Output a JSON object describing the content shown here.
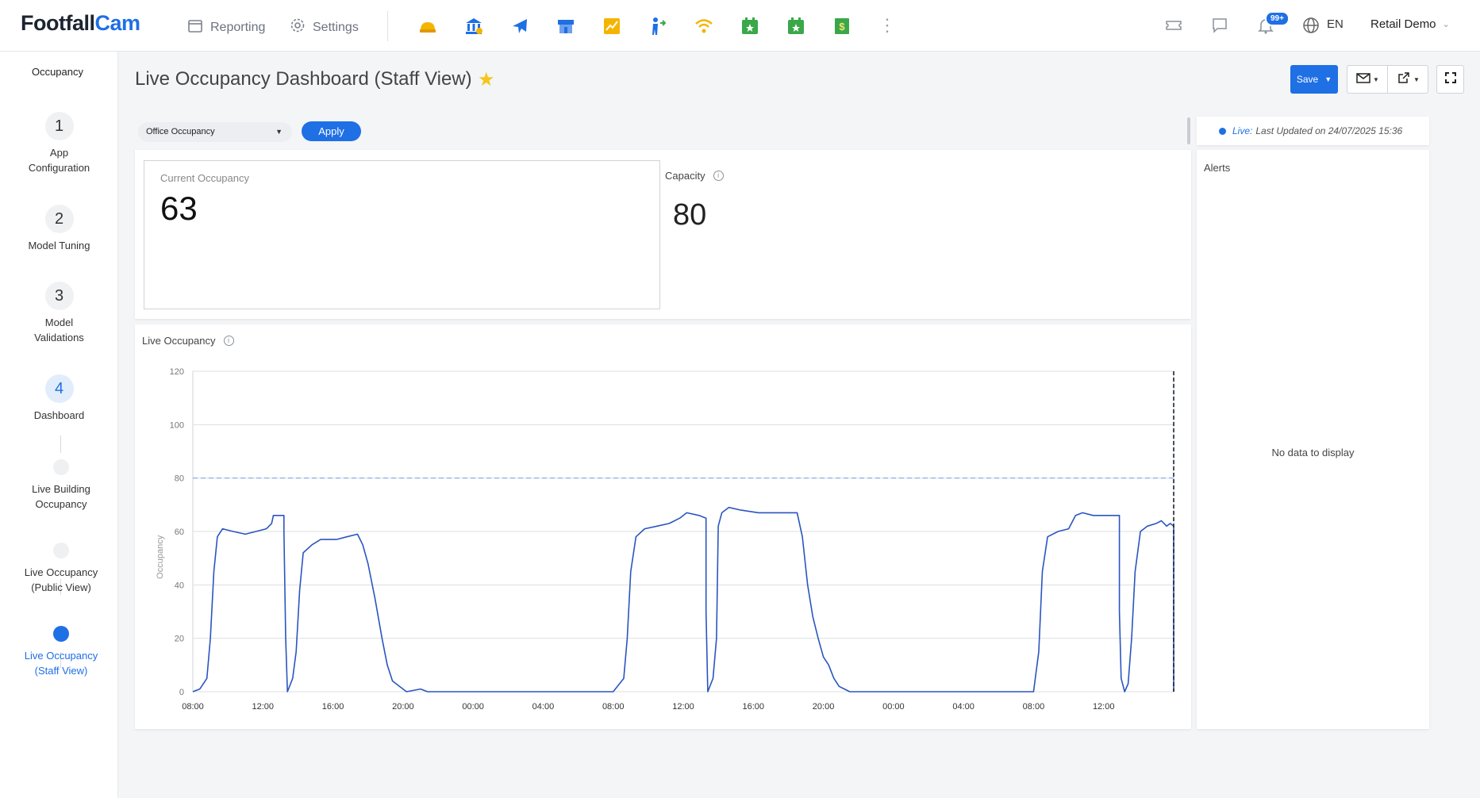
{
  "header": {
    "logo_main": "Footfall",
    "logo_accent": "Cam",
    "nav": [
      {
        "label": "Reporting",
        "icon": "calendar-icon"
      },
      {
        "label": "Settings",
        "icon": "gear-icon"
      }
    ],
    "app_icons": [
      {
        "name": "hard-hat-icon",
        "color": "#f5b400"
      },
      {
        "name": "bank-icon",
        "color": "#1f6fe5"
      },
      {
        "name": "airplane-icon",
        "color": "#1f6fe5"
      },
      {
        "name": "store-icon",
        "color": "#1f6fe5"
      },
      {
        "name": "chart-up-icon",
        "color": "#f5b400"
      },
      {
        "name": "people-transfer-icon",
        "color": "#1f6fe5"
      },
      {
        "name": "wifi-icon",
        "color": "#f5b400"
      },
      {
        "name": "calendar-star-icon",
        "color": "#3aa84a"
      },
      {
        "name": "calendar-star-icon",
        "color": "#3aa84a"
      },
      {
        "name": "dollar-doc-icon",
        "color": "#3aa84a"
      }
    ],
    "notifications_badge": "99+",
    "language": "EN",
    "account": "Retail Demo"
  },
  "sidebar": {
    "title": "Occupancy",
    "steps": [
      {
        "number": "1",
        "label_lines": [
          "App",
          "Configuration"
        ]
      },
      {
        "number": "2",
        "label_lines": [
          "Model Tuning"
        ]
      },
      {
        "number": "3",
        "label_lines": [
          "Model",
          "Validations"
        ]
      },
      {
        "number": "4",
        "label_lines": [
          "Dashboard"
        ]
      }
    ],
    "subitems": [
      {
        "label_lines": [
          "Live Building",
          "Occupancy"
        ]
      },
      {
        "label_lines": [
          "Live Occupancy",
          "(Public View)"
        ]
      },
      {
        "label_lines": [
          "Live Occupancy",
          "(Staff View)"
        ]
      }
    ]
  },
  "page": {
    "title": "Live Occupancy Dashboard (Staff View)",
    "save_label": "Save",
    "filter_value": "Office Occupancy",
    "apply_label": "Apply",
    "live_word": "Live:",
    "last_updated": "Last Updated on 24/07/2025 15:36"
  },
  "kpis": {
    "current_label": "Current Occupancy",
    "current_value": "63",
    "capacity_label": "Capacity",
    "capacity_value": "80"
  },
  "alerts": {
    "title": "Alerts",
    "empty_text": "No data to display"
  },
  "colors": {
    "accent": "#1f6fe5",
    "line": "#2a55c0",
    "capacity_line": "#7fa8e8"
  },
  "chart_data": {
    "type": "line",
    "title": "Live Occupancy",
    "ylabel": "Occupancy",
    "xlabel": "",
    "ylim": [
      0,
      120
    ],
    "yticks": [
      0,
      20,
      40,
      60,
      80,
      100,
      120
    ],
    "x_start": "08:00 day 1",
    "x_unit": "hours elapsed",
    "xlim": [
      0,
      56
    ],
    "xticks": [
      {
        "x": 0,
        "label": "08:00"
      },
      {
        "x": 4,
        "label": "12:00"
      },
      {
        "x": 8,
        "label": "16:00"
      },
      {
        "x": 12,
        "label": "20:00"
      },
      {
        "x": 16,
        "label": "00:00"
      },
      {
        "x": 20,
        "label": "04:00"
      },
      {
        "x": 24,
        "label": "08:00"
      },
      {
        "x": 28,
        "label": "12:00"
      },
      {
        "x": 32,
        "label": "16:00"
      },
      {
        "x": 36,
        "label": "20:00"
      },
      {
        "x": 40,
        "label": "00:00"
      },
      {
        "x": 44,
        "label": "04:00"
      },
      {
        "x": 48,
        "label": "08:00"
      },
      {
        "x": 52,
        "label": "12:00"
      }
    ],
    "capacity_line": 80,
    "current_time_marker": 56,
    "grid": true,
    "series": [
      {
        "name": "Occupancy",
        "points": [
          [
            0,
            0
          ],
          [
            0.4,
            1
          ],
          [
            0.8,
            5
          ],
          [
            1.0,
            20
          ],
          [
            1.2,
            45
          ],
          [
            1.4,
            58
          ],
          [
            1.7,
            61
          ],
          [
            2.3,
            60
          ],
          [
            3.0,
            59
          ],
          [
            3.6,
            60
          ],
          [
            4.2,
            61
          ],
          [
            4.5,
            63
          ],
          [
            4.6,
            66
          ],
          [
            5.2,
            66
          ],
          [
            5.2,
            60
          ],
          [
            5.3,
            20
          ],
          [
            5.4,
            0
          ],
          [
            5.7,
            5
          ],
          [
            5.9,
            15
          ],
          [
            6.1,
            38
          ],
          [
            6.3,
            52
          ],
          [
            6.8,
            55
          ],
          [
            7.3,
            57
          ],
          [
            8.2,
            57
          ],
          [
            8.8,
            58
          ],
          [
            9.4,
            59
          ],
          [
            9.7,
            55
          ],
          [
            10.0,
            48
          ],
          [
            10.4,
            35
          ],
          [
            10.8,
            20
          ],
          [
            11.1,
            10
          ],
          [
            11.4,
            4
          ],
          [
            11.8,
            2
          ],
          [
            12.2,
            0
          ],
          [
            13.0,
            1
          ],
          [
            13.4,
            0
          ],
          [
            24.0,
            0
          ],
          [
            24.6,
            5
          ],
          [
            24.8,
            20
          ],
          [
            25.0,
            45
          ],
          [
            25.3,
            58
          ],
          [
            25.8,
            61
          ],
          [
            26.5,
            62
          ],
          [
            27.2,
            63
          ],
          [
            27.8,
            65
          ],
          [
            28.2,
            67
          ],
          [
            28.9,
            66
          ],
          [
            29.3,
            65
          ],
          [
            29.3,
            30
          ],
          [
            29.4,
            0
          ],
          [
            29.7,
            5
          ],
          [
            29.9,
            20
          ],
          [
            30.0,
            62
          ],
          [
            30.2,
            67
          ],
          [
            30.6,
            69
          ],
          [
            31.3,
            68
          ],
          [
            32.3,
            67
          ],
          [
            33.5,
            67
          ],
          [
            34.5,
            67
          ],
          [
            34.8,
            58
          ],
          [
            35.1,
            40
          ],
          [
            35.4,
            28
          ],
          [
            35.7,
            20
          ],
          [
            36.0,
            13
          ],
          [
            36.3,
            10
          ],
          [
            36.6,
            5
          ],
          [
            36.9,
            2
          ],
          [
            37.2,
            1
          ],
          [
            37.5,
            0
          ],
          [
            48.0,
            0
          ],
          [
            48.3,
            15
          ],
          [
            48.5,
            45
          ],
          [
            48.8,
            58
          ],
          [
            49.4,
            60
          ],
          [
            50.0,
            61
          ],
          [
            50.4,
            66
          ],
          [
            50.8,
            67
          ],
          [
            51.4,
            66
          ],
          [
            52.4,
            66
          ],
          [
            52.9,
            66
          ],
          [
            52.9,
            30
          ],
          [
            53.0,
            5
          ],
          [
            53.2,
            0
          ],
          [
            53.4,
            3
          ],
          [
            53.6,
            20
          ],
          [
            53.8,
            45
          ],
          [
            54.1,
            60
          ],
          [
            54.5,
            62
          ],
          [
            55.0,
            63
          ],
          [
            55.3,
            64
          ],
          [
            55.6,
            62
          ],
          [
            55.8,
            63
          ],
          [
            56.0,
            62
          ],
          [
            56.0,
            0
          ]
        ]
      }
    ]
  }
}
